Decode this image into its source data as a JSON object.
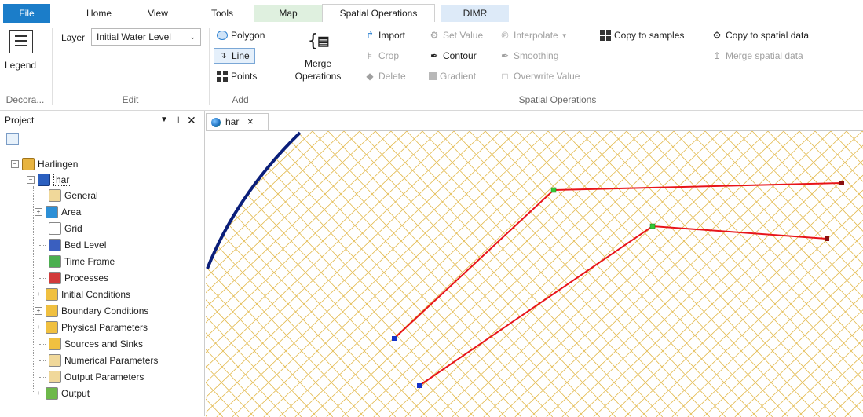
{
  "tabs": {
    "file": "File",
    "home": "Home",
    "view": "View",
    "tools": "Tools",
    "map": "Map",
    "spatial_operations": "Spatial Operations",
    "dimr": "DIMR"
  },
  "ribbon": {
    "legend": "Legend",
    "decoration_group": "Decora...",
    "layer_label": "Layer",
    "layer_value": "Initial Water Level",
    "edit_group": "Edit",
    "polygon": "Polygon",
    "line": "Line",
    "points": "Points",
    "add_group": "Add",
    "merge_line1": "Merge",
    "merge_line2": "Operations",
    "import": "Import",
    "crop": "Crop",
    "delete": "Delete",
    "set_value": "Set Value",
    "contour": "Contour",
    "gradient": "Gradient",
    "interpolate": "Interpolate",
    "smoothing": "Smoothing",
    "overwrite_value": "Overwrite Value",
    "copy_to_samples": "Copy to samples",
    "copy_to_spatial_data": "Copy to spatial data",
    "merge_spatial_data": "Merge spatial data",
    "spatial_ops_group": "Spatial Operations"
  },
  "project": {
    "title": "Project",
    "root": "Harlingen",
    "model": "har",
    "items": [
      {
        "label": "General",
        "color": "#f0d89a",
        "expander": false
      },
      {
        "label": "Area",
        "color": "#2c8fd6",
        "expander": true
      },
      {
        "label": "Grid",
        "color": "#ffffff",
        "expander": false
      },
      {
        "label": "Bed Level",
        "color": "#3a5fbf",
        "expander": false
      },
      {
        "label": "Time Frame",
        "color": "#4caf50",
        "expander": false
      },
      {
        "label": "Processes",
        "color": "#d23a3a",
        "expander": false
      },
      {
        "label": "Initial Conditions",
        "color": "#f0c040",
        "expander": true
      },
      {
        "label": "Boundary Conditions",
        "color": "#f0c040",
        "expander": true
      },
      {
        "label": "Physical Parameters",
        "color": "#f0c040",
        "expander": true
      },
      {
        "label": "Sources and Sinks",
        "color": "#f0c040",
        "expander": false
      },
      {
        "label": "Numerical Parameters",
        "color": "#f0d89a",
        "expander": false
      },
      {
        "label": "Output Parameters",
        "color": "#f0d89a",
        "expander": false
      },
      {
        "label": "Output",
        "color": "#6db84a",
        "expander": true
      }
    ]
  },
  "document": {
    "tab_label": "har",
    "close": "×"
  },
  "map_colors": {
    "grid": "#e2b84a",
    "line": "#e8141a",
    "boundary": "#0b1f7a"
  }
}
